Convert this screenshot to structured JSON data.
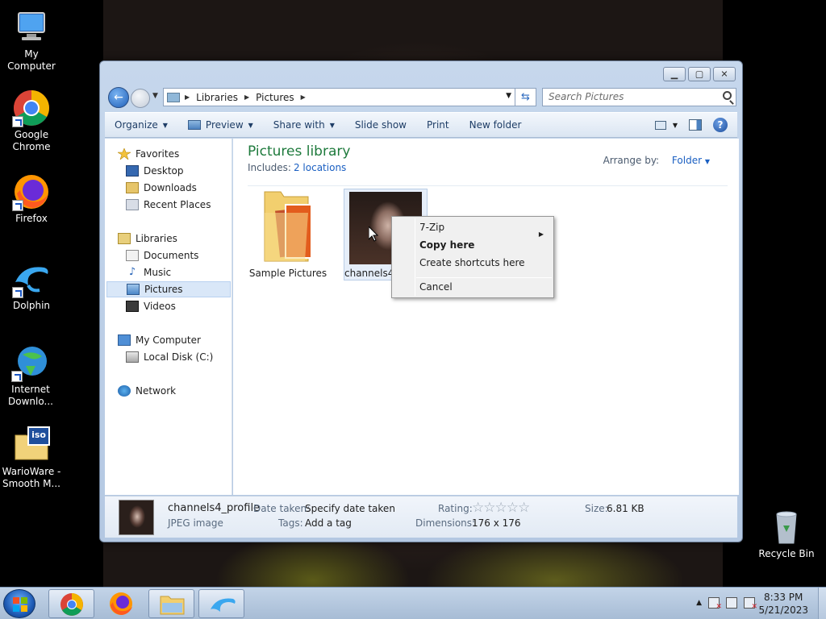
{
  "desktop": {
    "icons": [
      {
        "label": "My Computer",
        "icon": "computer-icon"
      },
      {
        "label": "Google Chrome",
        "icon": "chrome-icon"
      },
      {
        "label": "Firefox",
        "icon": "firefox-icon"
      },
      {
        "label": "Dolphin",
        "icon": "dolphin-icon"
      },
      {
        "label": "Internet Downlo...",
        "icon": "idm-icon"
      },
      {
        "label": "WarioWare - Smooth M...",
        "icon": "iso-icon"
      }
    ],
    "recycle_bin": "Recycle Bin",
    "iso_badge": "iso"
  },
  "window": {
    "address": {
      "crumbs": [
        "Libraries",
        "Pictures"
      ],
      "search_placeholder": "Search Pictures"
    },
    "commands": [
      "Organize",
      "Preview",
      "Share with",
      "Slide show",
      "Print",
      "New folder"
    ],
    "nav": {
      "favorites": "Favorites",
      "favorites_items": [
        "Desktop",
        "Downloads",
        "Recent Places"
      ],
      "libraries": "Libraries",
      "libraries_items": [
        "Documents",
        "Music",
        "Pictures",
        "Videos"
      ],
      "computer": "My Computer",
      "computer_items": [
        "Local Disk (C:)"
      ],
      "network": "Network",
      "selected": "Pictures"
    },
    "content": {
      "title": "Pictures library",
      "includes_label": "Includes:",
      "includes_link": "2 locations",
      "arrange_label": "Arrange by:",
      "arrange_value": "Folder",
      "items": [
        {
          "name": "Sample Pictures",
          "type": "folder"
        },
        {
          "name": "channels4_profile",
          "type": "image"
        }
      ]
    },
    "context_menu": {
      "items": [
        {
          "label": "7-Zip",
          "submenu": true
        },
        {
          "label": "Copy here",
          "bold": true
        },
        {
          "label": "Create shortcuts here"
        },
        {
          "label": "Cancel"
        }
      ]
    },
    "details": {
      "name": "channels4_profile",
      "type": "JPEG image",
      "date_label": "Date taken:",
      "date_value": "Specify date taken",
      "tags_label": "Tags:",
      "tags_value": "Add a tag",
      "rating_label": "Rating:",
      "rating_stars": "☆☆☆☆☆",
      "dimensions_label": "Dimensions:",
      "dimensions_value": "176 x 176",
      "size_label": "Size:",
      "size_value": "6.81 KB"
    }
  },
  "taskbar": {
    "time": "8:33 PM",
    "date": "5/21/2023"
  },
  "colors": {
    "library_title": "#1e7a3c",
    "link": "#1a5fc2"
  }
}
